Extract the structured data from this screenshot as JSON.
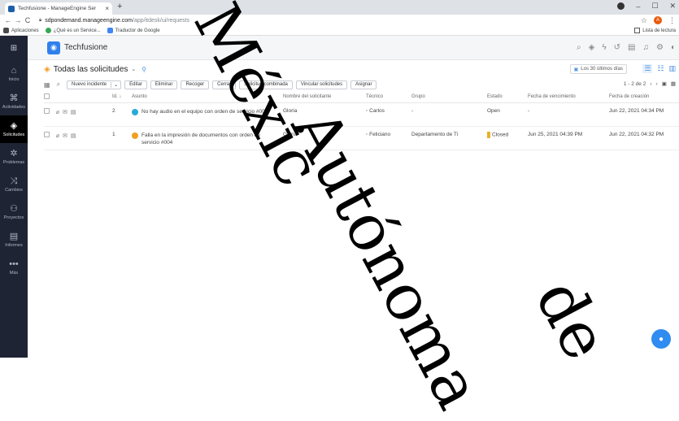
{
  "browser": {
    "tab_title": "Techfusione - ManageEngine Ser",
    "tab_close": "×",
    "new_tab": "+",
    "url_host": "sdpondemand.manageengine.com",
    "url_path": "/app/itdesk/ui/requests",
    "profile_initial": "A",
    "bookmarks": [
      {
        "label": "Aplicaciones",
        "color": "#4a4a4a"
      },
      {
        "label": "¿Qué es un Service...",
        "color": "#34a853"
      },
      {
        "label": "Traductor de Google",
        "color": "#4285f4"
      }
    ],
    "reading_list": "Lista de lectura"
  },
  "sidebar": {
    "items": [
      {
        "label": "Inicio",
        "icon": "home-icon",
        "glyph": "⌂",
        "active": false
      },
      {
        "label": "Actividades",
        "icon": "activities-icon",
        "glyph": "⌘",
        "active": false
      },
      {
        "label": "Solicitudes",
        "icon": "requests-icon",
        "glyph": "◈",
        "active": true
      },
      {
        "label": "Problemas",
        "icon": "problems-icon",
        "glyph": "✲",
        "active": false
      },
      {
        "label": "Cambios",
        "icon": "changes-icon",
        "glyph": "⤨",
        "active": false
      },
      {
        "label": "Proyectos",
        "icon": "projects-icon",
        "glyph": "⚇",
        "active": false
      },
      {
        "label": "Informes",
        "icon": "reports-icon",
        "glyph": "▤",
        "active": false
      },
      {
        "label": "Más",
        "icon": "more-icon",
        "glyph": "•••",
        "active": false
      }
    ]
  },
  "topbar": {
    "brand": "Techfusione"
  },
  "header": {
    "title": "Todas las solicitudes",
    "period": "Los 30 últimos días"
  },
  "toolbar": {
    "new_incident": "Nuevo incidente",
    "edit": "Editar",
    "delete": "Eliminar",
    "pick_up": "Recoger",
    "close": "Cerrar",
    "merge": "Solicitud combinada",
    "link": "Vincular solicitudes",
    "assign": "Asignar",
    "pagination": "1 - 2 de 2"
  },
  "table": {
    "columns": {
      "id": "Id.",
      "subject": "Asunto",
      "requester": "Nombre del solicitante",
      "technician": "Técnico",
      "group": "Grupo",
      "status": "Estado",
      "due": "Fecha de vencimiento",
      "created": "Fecha de creación"
    },
    "rows": [
      {
        "id": "2",
        "subject": "No hay audio en el equipo con orden de servicio #002",
        "subject_color": "#2aa9d8",
        "requester": "Gloria",
        "technician": "Carlos",
        "group": "-",
        "status": "Open",
        "status_color": "",
        "due": "-",
        "created": "Jun 22, 2021 04:34 PM"
      },
      {
        "id": "1",
        "subject": "Falla en la impresión de documentos con orden de servicio #004",
        "subject_color": "#f0a020",
        "requester": "Gloria",
        "technician": "Feliciano",
        "group": "Departamento de Ti",
        "status": "Closed",
        "status_color": "#e8b12a",
        "due": "Jun 25, 2021 04:39 PM",
        "created": "Jun 22, 2021 04:32 PM"
      }
    ]
  },
  "watermark": [
    "Autónoma",
    "de",
    "Méxic"
  ]
}
